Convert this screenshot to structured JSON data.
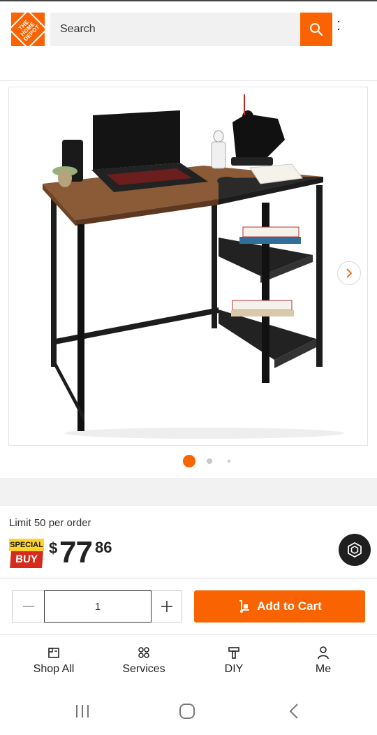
{
  "header": {
    "logo_text": "THE HOME DEPOT",
    "search_placeholder": "Search"
  },
  "gallery": {
    "image_alt": "Rustic brown computer desk with black metal frame and side shelves",
    "total_images": 3,
    "active_index": 0
  },
  "product": {
    "limit_text": "Limit 50 per order",
    "badge_top": "SPECIAL",
    "badge_bottom": "BUY",
    "price_currency": "$",
    "price_dollars": "77",
    "price_cents": "86"
  },
  "cart": {
    "quantity": "1",
    "add_label": "Add to Cart"
  },
  "bottom_nav": {
    "items": [
      {
        "label": "Shop All",
        "icon": "shop-all-icon"
      },
      {
        "label": "Services",
        "icon": "services-icon"
      },
      {
        "label": "DIY",
        "icon": "diy-icon"
      },
      {
        "label": "Me",
        "icon": "person-icon"
      }
    ]
  },
  "colors": {
    "brand_orange": "#f96302",
    "special_yellow": "#ffd32a",
    "special_red": "#d52b1e"
  }
}
